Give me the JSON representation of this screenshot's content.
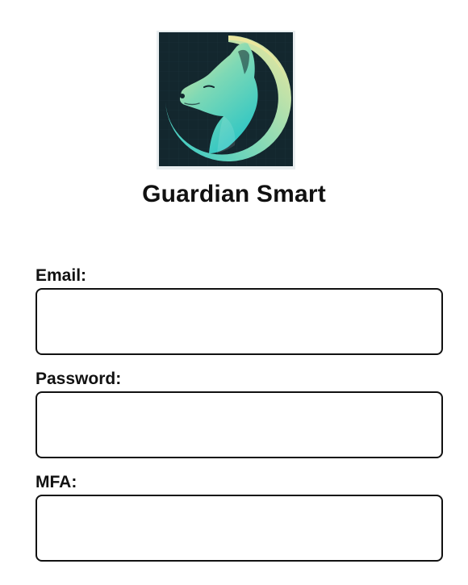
{
  "app": {
    "title": "Guardian Smart",
    "logo_icon": "wolf-moon-logo-icon"
  },
  "colors": {
    "logo_background": "#13272e",
    "logo_teal": "#36d0c8",
    "logo_gold": "#f1e59a",
    "border": "#111111"
  },
  "form": {
    "email": {
      "label": "Email:",
      "value": "",
      "placeholder": ""
    },
    "password": {
      "label": "Password:",
      "value": "",
      "placeholder": ""
    },
    "mfa": {
      "label": "MFA:",
      "value": "",
      "placeholder": ""
    }
  }
}
